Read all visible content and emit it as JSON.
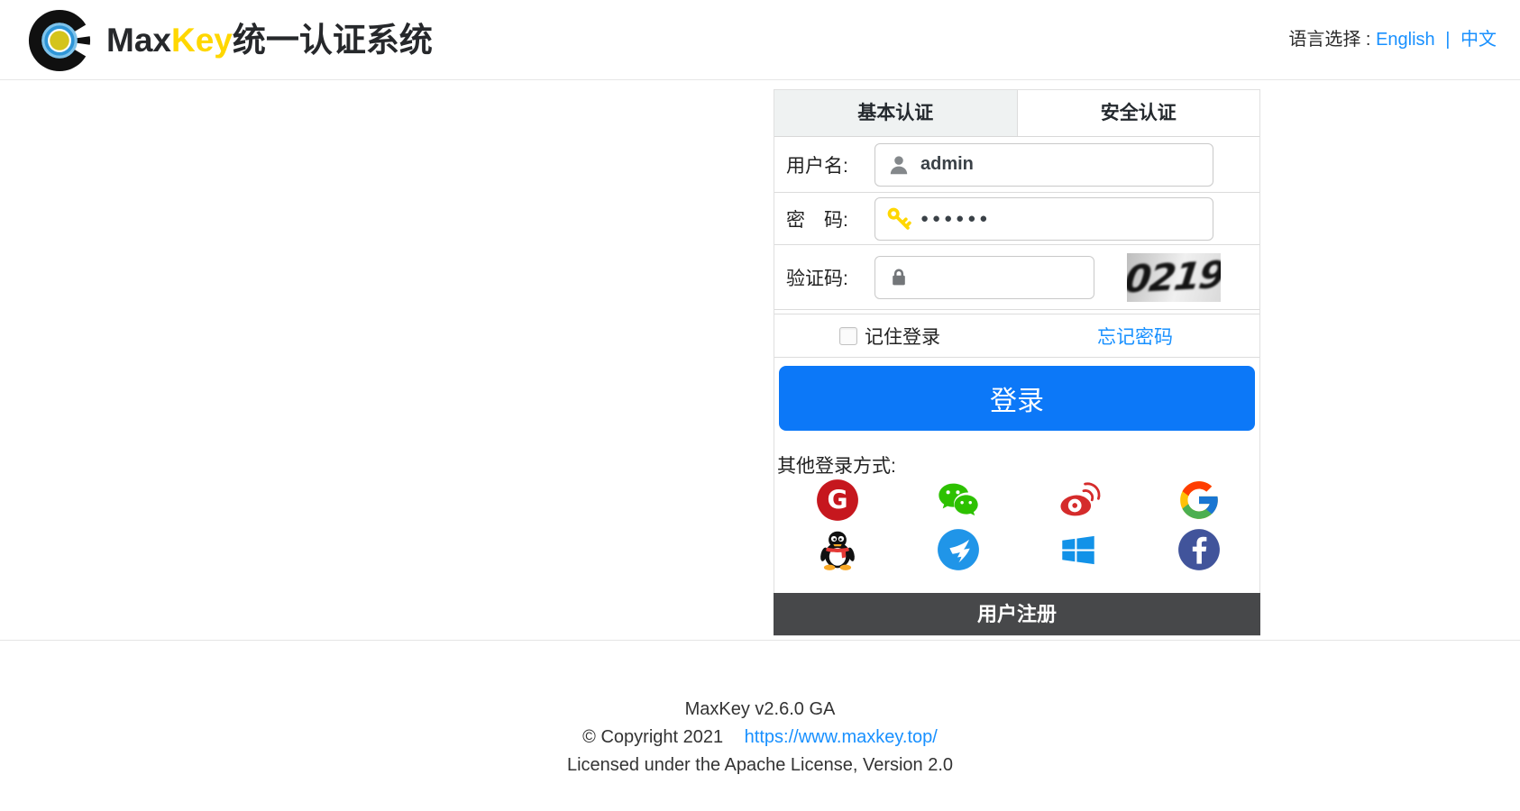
{
  "header": {
    "brand": {
      "part1": "Max",
      "part2": "Key",
      "part3": "统一认证系统"
    },
    "language": {
      "label": "语言选择 :",
      "english": "English",
      "separator": "|",
      "chinese": "中文"
    }
  },
  "login": {
    "tabs": [
      {
        "label": "基本认证"
      },
      {
        "label": "安全认证"
      }
    ],
    "fields": {
      "username": {
        "label": "用户名:",
        "value": "admin",
        "icon": "user-icon"
      },
      "password": {
        "label": "密　码:",
        "value": "●●●●●●",
        "icon": "key-icon"
      },
      "captcha": {
        "label": "验证码:",
        "value": "",
        "icon": "lock-icon",
        "image_text": "0219"
      }
    },
    "remember_label": "记住登录",
    "forgot_label": "忘记密码",
    "submit_label": "登录",
    "other_methods_label": "其他登录方式:",
    "providers_row1": [
      "gitee",
      "wechat",
      "weibo",
      "google"
    ],
    "providers_row2": [
      "qq",
      "dingtalk",
      "microsoft",
      "facebook"
    ],
    "register_label": "用户注册"
  },
  "footer": {
    "line1": "MaxKey  v2.6.0 GA",
    "line2_prefix": "© Copyright 2021",
    "line2_link": "https://www.maxkey.top/",
    "line3": "Licensed under the Apache License, Version 2.0"
  },
  "colors": {
    "primary_button": "#0c78f8",
    "link": "#1890ff",
    "brand_yellow": "#ffd700",
    "register_bar": "#47484a",
    "tab_active_bg": "#eff2f2"
  }
}
